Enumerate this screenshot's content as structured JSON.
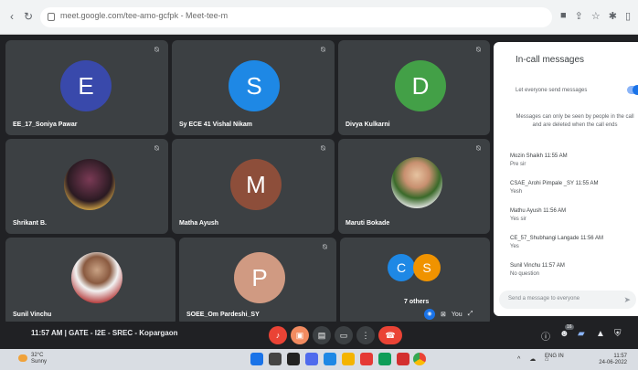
{
  "browser": {
    "url": "meet.google.com/tee-amo-gcfpk - Meet-tee-m",
    "icons": [
      "back-icon",
      "reload-icon",
      "lock-icon",
      "camera-icon",
      "share-icon",
      "star-icon",
      "extension-icon",
      "sidebar-icon"
    ]
  },
  "tiles": [
    {
      "name": "EE_17_Soniya Pawar",
      "initial": "E",
      "color": "#3949ab"
    },
    {
      "name": "Sy ECE 41 Vishal Nikam",
      "initial": "S",
      "color": "#1e88e5"
    },
    {
      "name": "Divya Kulkarni",
      "initial": "D",
      "color": "#43a047"
    },
    {
      "name": "Shrikant B."
    },
    {
      "name": "Matha Ayush",
      "initial": "M",
      "color": "#8d4e3a"
    },
    {
      "name": "Maruti Bokade"
    },
    {
      "name": "Sunil Vinchu"
    },
    {
      "name": "SOEE_Om Pardeshi_SY",
      "initial": "P",
      "color": "#d09a82"
    },
    {
      "name": "7 others",
      "initial": "C",
      "initial2": "S",
      "color": "#1e88e5",
      "color2": "#f09300"
    }
  ],
  "self_view": {
    "label": "You"
  },
  "chat": {
    "title": "In-call messages",
    "toggle_label": "Let everyone send messages",
    "note": "Messages can only be seen by people in the call and are deleted when the call ends",
    "messages": [
      {
        "sender": "Mozin Shaikh  11:55 AM",
        "text": "Pre sir"
      },
      {
        "sender": "CSAE_Arohi Pimpale _SY  11:55 AM",
        "text": "Yesh"
      },
      {
        "sender": "Mathu Ayush  11:56 AM",
        "text": "Yes sir"
      },
      {
        "sender": "CE_57_Shubhangi Langade  11:56 AM",
        "text": "Yes"
      },
      {
        "sender": "Sunil Vinchu  11:57 AM",
        "text": "No question"
      }
    ],
    "input_placeholder": "Send a message to everyone"
  },
  "bottombar": {
    "time_info": "11:57 AM  |  GATE - I2E - SREC - Kopargaon",
    "participants_badge": "16"
  },
  "taskbar": {
    "weather_temp": "32°C",
    "weather_desc": "Sunny",
    "lang": "ENG IN",
    "time": "11:57",
    "date": "24-06-2022"
  }
}
